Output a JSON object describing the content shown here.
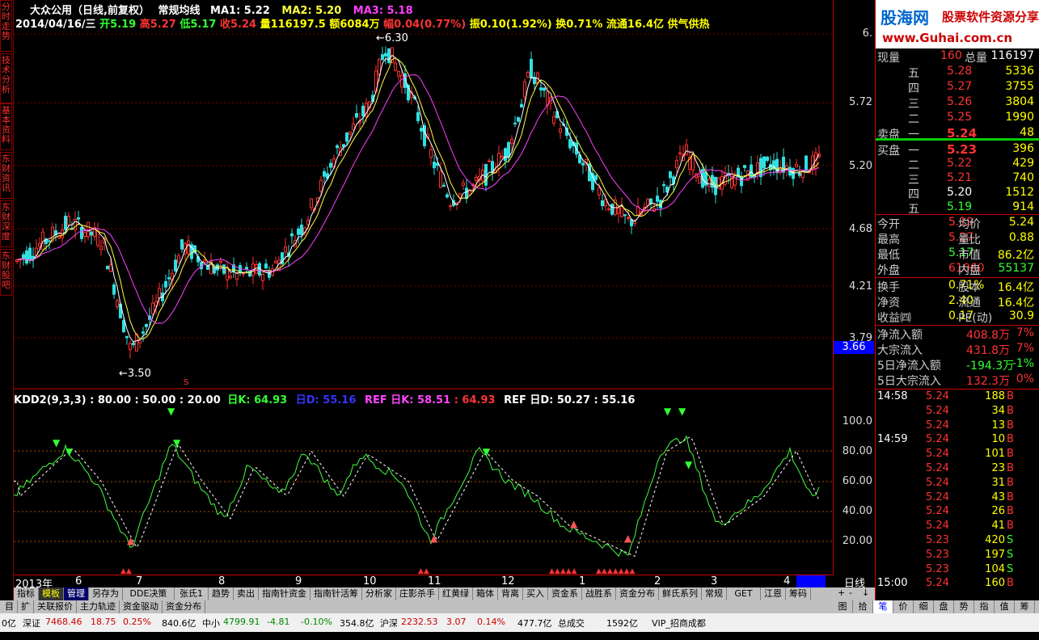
{
  "left_tabs": [
    "分时走势",
    "技术分析",
    "基本资料",
    "东财资讯",
    "东财深度",
    "东财股吧"
  ],
  "header": {
    "line1": {
      "name": "大众公用（日线,前复权）",
      "ma_title": "常规均线",
      "ma1": "MA1: 5.22",
      "ma2": "MA2: 5.20",
      "ma3": "MA3: 5.18"
    },
    "line2": {
      "date": "2014/04/16/三",
      "open": "开5.19",
      "high": "高5.27",
      "low": "低5.17",
      "close": "收5.24",
      "vol": "量116197.5",
      "amount": "额6084万",
      "change": "幅0.04(0.77%)",
      "amp": "振0.10(1.92%)",
      "turn": "换0.71%",
      "float": "流通16.4亿",
      "tag": "供气供热"
    }
  },
  "price_axis": [
    "6.",
    "5.72",
    "5.20",
    "4.68",
    "4.21",
    "3.79"
  ],
  "price_tag": "3.66",
  "markers": {
    "high": "6.30",
    "low": "3.50",
    "s": "S"
  },
  "indicator": {
    "title": "KDD2(9,3,3)",
    "p1": ": 80.00",
    "p2": ": 50.00",
    "p3": ": 20.00",
    "k": "日K: 64.93",
    "d": "日D: 55.16",
    "ref1": "REF 日K: 58.51",
    "ref1b": ": 64.93",
    "ref2": "REF 日D: 50.27",
    "ref2b": ": 55.16",
    "levels": [
      "100.0",
      "80.00",
      "60.00",
      "40.00",
      "20.00"
    ]
  },
  "x_axis": {
    "year": "2013年",
    "months": [
      "6",
      "7",
      "8",
      "9",
      "10",
      "11",
      "12",
      "1",
      "2",
      "3",
      "4"
    ],
    "period": "日线"
  },
  "chart_data": {
    "type": "candlestick",
    "title": "大众公用（日线,前复权）",
    "ylim": [
      3.5,
      6.3
    ],
    "y_ticks": [
      4.21,
      4.68,
      5.2,
      5.72
    ],
    "annotated_high": 6.3,
    "annotated_low": 3.5,
    "last_close": 5.24,
    "ma": {
      "MA1": 5.22,
      "MA2": 5.2,
      "MA3": 5.18
    },
    "kdj": {
      "K": 64.93,
      "D": 55.16,
      "levels": [
        20,
        40,
        60,
        80,
        100
      ]
    }
  },
  "quote": {
    "xianliang_label": "现量",
    "xianliang": "160",
    "zongliang_label": "总量",
    "zongliang": "116197",
    "sell": [
      {
        "label": "五",
        "price": "5.28",
        "vol": "5336"
      },
      {
        "label": "四",
        "price": "5.27",
        "vol": "3755"
      },
      {
        "label": "三",
        "price": "5.26",
        "vol": "3804"
      },
      {
        "label": "二",
        "price": "5.25",
        "vol": "1990"
      },
      {
        "label": "一",
        "price": "5.24",
        "vol": "48"
      }
    ],
    "sell_label": "卖盘",
    "buy_label": "买盘",
    "buy": [
      {
        "label": "一",
        "price": "5.23",
        "vol": "396"
      },
      {
        "label": "二",
        "price": "5.22",
        "vol": "429"
      },
      {
        "label": "三",
        "price": "5.21",
        "vol": "740"
      },
      {
        "label": "四",
        "price": "5.20",
        "vol": "1512"
      },
      {
        "label": "五",
        "price": "5.19",
        "vol": "914"
      }
    ],
    "stats": [
      {
        "l1": "今开",
        "v1": "5.19",
        "l2": "均价",
        "v2": "5.24"
      },
      {
        "l1": "最高",
        "v1": "5.27",
        "l2": "量比",
        "v2": "0.88"
      },
      {
        "l1": "最低",
        "v1": "5.17",
        "l2": "市值",
        "v2": "86.2亿"
      },
      {
        "l1": "外盘",
        "v1": "61060",
        "l2": "内盘",
        "v2": "55137"
      }
    ],
    "stats2": [
      {
        "l1": "换手",
        "v1": "0.71%",
        "l2": "股本",
        "v2": "16.4亿"
      },
      {
        "l1": "净资",
        "v1": "2.40",
        "l2": "流通",
        "v2": "16.4亿"
      },
      {
        "l1": "收益㈣",
        "v1": "0.17",
        "l2": "PE(动)",
        "v2": "30.9"
      }
    ],
    "flows": [
      {
        "label": "净流入额",
        "value": "408.8万",
        "pct": "7%"
      },
      {
        "label": "大宗流入",
        "value": "431.8万",
        "pct": "7%"
      },
      {
        "label": "5日净流入额",
        "value": "-194.3万",
        "pct": "-1%"
      },
      {
        "label": "5日大宗流入",
        "value": "132.3万",
        "pct": "0%"
      }
    ]
  },
  "trades": [
    {
      "time": "14:58",
      "price": "5.24",
      "vol": "188",
      "bs": "B"
    },
    {
      "time": "",
      "price": "5.24",
      "vol": "34",
      "bs": "B"
    },
    {
      "time": "",
      "price": "5.24",
      "vol": "13",
      "bs": "B"
    },
    {
      "time": "14:59",
      "price": "5.24",
      "vol": "10",
      "bs": "B"
    },
    {
      "time": "",
      "price": "5.24",
      "vol": "101",
      "bs": "B"
    },
    {
      "time": "",
      "price": "5.24",
      "vol": "23",
      "bs": "B"
    },
    {
      "time": "",
      "price": "5.24",
      "vol": "31",
      "bs": "B"
    },
    {
      "time": "",
      "price": "5.24",
      "vol": "43",
      "bs": "B"
    },
    {
      "time": "",
      "price": "5.24",
      "vol": "26",
      "bs": "B"
    },
    {
      "time": "",
      "price": "5.24",
      "vol": "41",
      "bs": "B"
    },
    {
      "time": "",
      "price": "5.23",
      "vol": "420",
      "bs": "S"
    },
    {
      "time": "",
      "price": "5.23",
      "vol": "197",
      "bs": "S"
    },
    {
      "time": "",
      "price": "5.23",
      "vol": "104",
      "bs": "S"
    },
    {
      "time": "15:00",
      "price": "5.24",
      "vol": "160",
      "bs": "B"
    }
  ],
  "logo": {
    "text": "股海网",
    "sub": "股票软件资源分享",
    "url": "www.Guhai.com.cn"
  },
  "toolbar1": [
    "指标",
    "模板",
    "管理",
    "另存为",
    "DDE决策",
    "张氏1",
    "趋势",
    "卖出",
    "指南针资金",
    "指南针活筹",
    "分析家",
    "庄影杀手",
    "红黄绿",
    "箱体",
    "背离",
    "买入",
    "资金系",
    "战胜系",
    "资金分布",
    "鲜氏系列",
    "常规",
    "GET",
    "江恩",
    "筹码"
  ],
  "toolbar2": [
    "目",
    "扩",
    "关联报价",
    "主力轨迹",
    "资金驱动",
    "资金分布"
  ],
  "right_tabs": [
    "图",
    "拾",
    "笔",
    "价",
    "细",
    "盘",
    "势",
    "指",
    "值",
    "筹"
  ],
  "status": {
    "s1": "0亿",
    "sz_label": "深证",
    "sz": "7468.46",
    "sz_ch": "18.75",
    "sz_pct": "0.25%",
    "sz_amt": "840.6亿",
    "zx_label": "中小",
    "zx": "4799.91",
    "zx_ch": "-4.81",
    "zx_pct": "-0.10%",
    "zx_amt": "354.8亿",
    "hs_label": "沪深",
    "hs": "2232.53",
    "hs_ch": "3.07",
    "hs_pct": "0.14%",
    "hs_amt": "477.7亿",
    "total_label": "总成交",
    "total": "1592亿",
    "vip": "VIP_招商成都"
  }
}
